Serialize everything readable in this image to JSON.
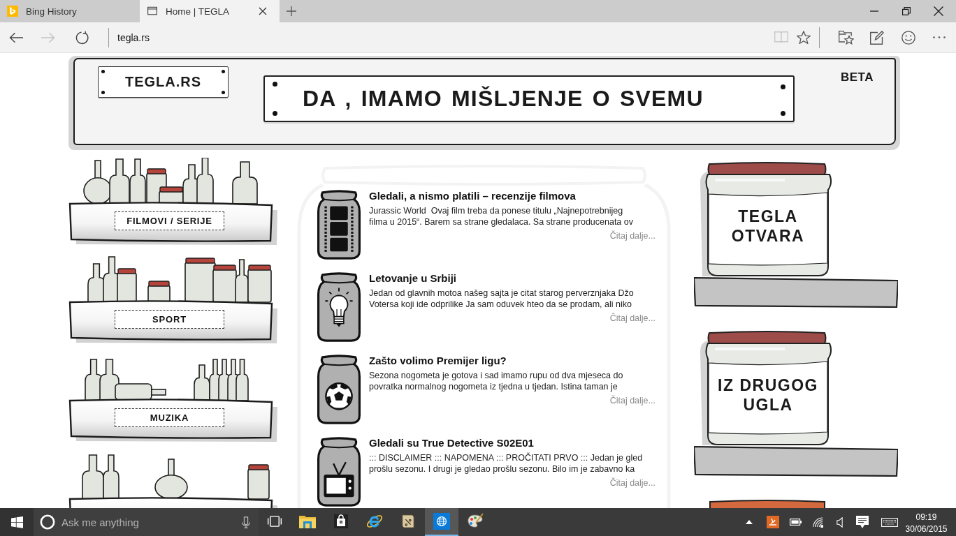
{
  "browser": {
    "tabs": [
      {
        "kind": "bing",
        "title": "Bing History",
        "selected": false
      },
      {
        "kind": "page",
        "title": "Home | TEGLA",
        "selected": true
      }
    ],
    "nav": [
      {
        "kind": "back",
        "disabled": false
      },
      {
        "kind": "forward",
        "disabled": true
      },
      {
        "kind": "refresh",
        "disabled": false
      }
    ],
    "address": "tegla.rs",
    "tools": [
      {
        "kind": "reading-view",
        "disabled": true
      },
      {
        "kind": "favorite",
        "disabled": false
      },
      {
        "kind": "hub",
        "disabled": false
      },
      {
        "kind": "note",
        "disabled": false
      },
      {
        "kind": "feedback",
        "disabled": false
      },
      {
        "kind": "more",
        "disabled": false
      }
    ]
  },
  "header": {
    "site_name": "TEGLA.RS",
    "slogan": "DA , IMAMO MIŠLJENJE O SVEMU",
    "badge": "BETA"
  },
  "categories": [
    {
      "label": "FILMOVI / SERIJE"
    },
    {
      "label": "SPORT"
    },
    {
      "label": "MUZIKA"
    }
  ],
  "articles": [
    {
      "kind": "film",
      "title": "Gledali, a nismo platili – recenzije filmova",
      "excerpt": [
        "Jurassic World  Ovaj film treba da ponese titulu „Najnepotrebnijeg",
        "filma u 2015“. Barem sa strane gledalaca. Sa strane producenata ov"
      ],
      "link": "Čitaj dalje..."
    },
    {
      "kind": "bulb",
      "title": "Letovanje u Srbiji",
      "excerpt": [
        "Jedan od glavnih motoa našeg sajta je citat starog perverznjaka Džo",
        "Votersa koji ide odprilike Ja sam oduvek hteo da se prodam, ali niko"
      ],
      "link": "Čitaj dalje..."
    },
    {
      "kind": "ball",
      "title": "Zašto volimo Premijer ligu?",
      "excerpt": [
        "Sezona nogometa je gotova i sad imamo rupu od dva mjeseca do",
        "povratka normalnog nogometa iz tjedna u tjedan. Istina taman je"
      ],
      "link": "Čitaj dalje..."
    },
    {
      "kind": "tv",
      "title": "Gledali su True Detective S02E01",
      "excerpt": [
        "::: DISCLAIMER ::: NAPOMENA ::: PROČITATI PRVO ::: Jedan je gled",
        "prošlu sezonu. I drugi je gledao prošlu sezonu. Bilo im je zabavno ka"
      ],
      "link": "Čitaj dalje..."
    }
  ],
  "columns": [
    {
      "label": "TEGLA OTVARA"
    },
    {
      "label": "IZ DRUGOG UGLA"
    }
  ],
  "taskbar": {
    "search": {
      "placeholder": "Ask me anything"
    },
    "apps": [
      {
        "kind": "task-view",
        "selected": false
      },
      {
        "kind": "folder",
        "selected": false
      },
      {
        "kind": "store",
        "selected": false
      },
      {
        "kind": "ie",
        "selected": false
      },
      {
        "kind": "scroll",
        "selected": false
      },
      {
        "kind": "edge",
        "selected": true
      },
      {
        "kind": "paint",
        "selected": false
      }
    ],
    "tray": [
      {
        "kind": "chevron"
      },
      {
        "kind": "app"
      },
      {
        "kind": "battery"
      },
      {
        "kind": "network"
      },
      {
        "kind": "volume"
      },
      {
        "kind": "notifications"
      },
      {
        "kind": "keyboard"
      }
    ],
    "time": "09:19",
    "date": "30/06/2015"
  }
}
